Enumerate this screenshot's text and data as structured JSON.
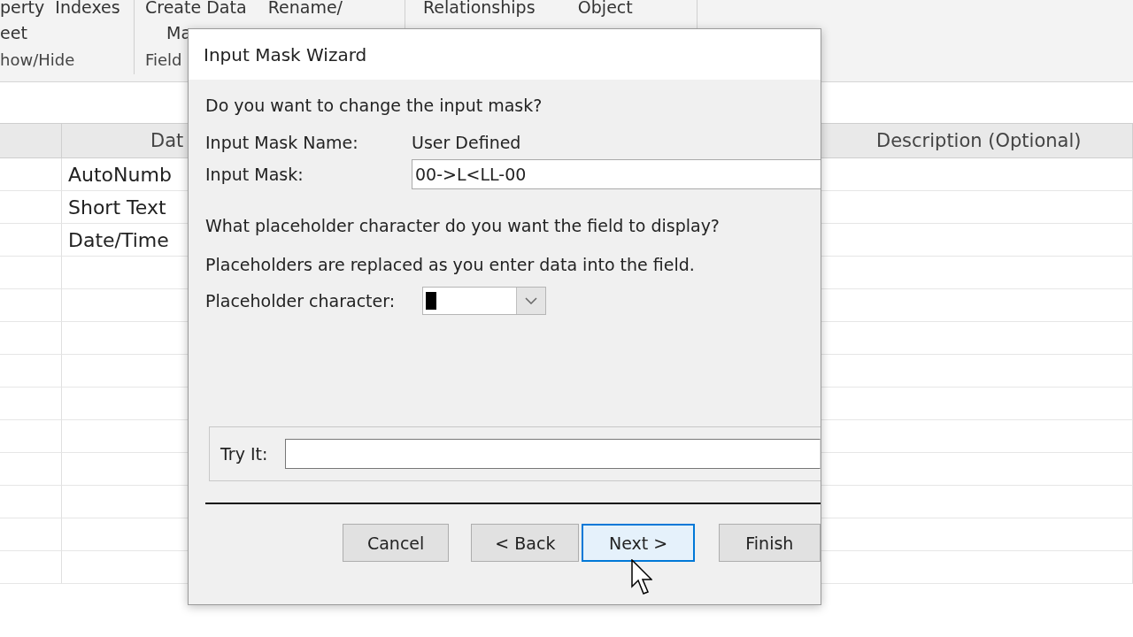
{
  "ribbon": {
    "groups": [
      {
        "lines": [
          "perty  Indexes",
          "eet"
        ],
        "caption": "how/Hide"
      },
      {
        "lines": [
          "Create Data    Rename/",
          "Ma"
        ],
        "caption": "Field"
      },
      {
        "lines": [
          "Relationships        Object"
        ]
      }
    ]
  },
  "table": {
    "columns": [
      "Dat",
      "Description (Optional)"
    ],
    "rows": [
      {
        "data_type": "AutoNumb"
      },
      {
        "data_type": "Short Text"
      },
      {
        "data_type": "Date/Time"
      }
    ]
  },
  "dialog": {
    "title": "Input Mask Wizard",
    "question": "Do you want to change the input mask?",
    "mask_name_label": "Input Mask Name:",
    "mask_name": "User Defined",
    "mask_label": "Input Mask:",
    "mask_value": "00->L<LL-00",
    "placeholder_question": "What placeholder character do you want the field to display?",
    "placeholder_note": "Placeholders are replaced as you enter data into the field.",
    "placeholder_label": "Placeholder character:",
    "try_label": "Try It:",
    "buttons": [
      {
        "label": "Cancel",
        "focused": false
      },
      {
        "label": "< Back",
        "focused": false
      },
      {
        "label": "Next >",
        "focused": true
      },
      {
        "label": "Finish",
        "focused": false
      }
    ]
  }
}
